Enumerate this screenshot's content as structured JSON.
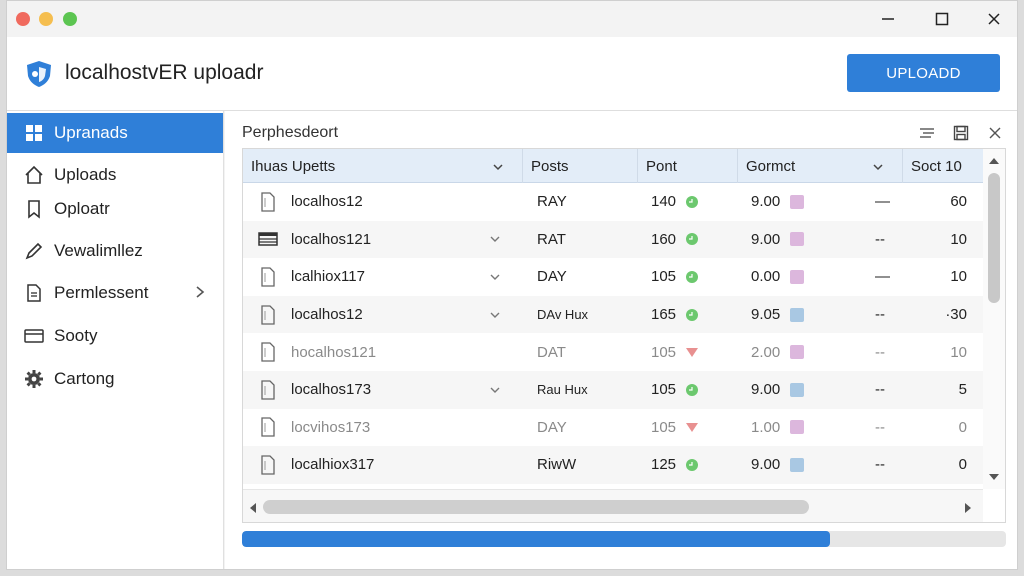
{
  "window": {
    "minimize": "—",
    "maximize": "☐",
    "close": "✕"
  },
  "header": {
    "title": "localhostvER uploadr",
    "upload_label": "UPLOADD"
  },
  "sidebar": {
    "items": [
      {
        "label": "Upranads",
        "icon": "grid-icon",
        "active": true
      },
      {
        "label": "Uploads",
        "icon": "home-icon"
      },
      {
        "label": "Oploatr",
        "icon": "bookmark-icon"
      },
      {
        "label": "Vewalimllez",
        "icon": "pen-icon"
      },
      {
        "label": "Permlessent",
        "icon": "document-icon",
        "chevron": "›"
      },
      {
        "label": "Sooty",
        "icon": "card-icon"
      },
      {
        "label": "Cartong",
        "icon": "gear-icon"
      }
    ]
  },
  "main": {
    "title": "Perphesdeort",
    "columns": [
      "Ihuas Upetts",
      "Posts",
      "Pont",
      "Gormct",
      "Soct 10"
    ],
    "rows": [
      {
        "icon": "file-icon",
        "name": "localhos12",
        "chevron": "",
        "type": "RAY",
        "point": "140",
        "dot": "green",
        "format": "9.00",
        "swatch": "pink",
        "dash": "—",
        "soct": "60"
      },
      {
        "icon": "table-icon",
        "name": "localhos121",
        "chevron": "⌄",
        "type": "RAT",
        "point": "160",
        "dot": "green",
        "format": "9.00",
        "swatch": "pink",
        "dash": "--",
        "soct": "10"
      },
      {
        "icon": "file-icon",
        "name": "lcalhiox117",
        "chevron": "⌄",
        "type": "DAY",
        "point": "105",
        "dot": "green",
        "format": "0.00",
        "swatch": "pink",
        "dash": "—",
        "soct": "10"
      },
      {
        "icon": "file-icon",
        "name": "localhos12",
        "chevron": "⌄",
        "type": "DAv Hux",
        "point": "165",
        "dot": "green",
        "format": "9.05",
        "swatch": "blue",
        "dash": "--",
        "soct": "·30"
      },
      {
        "icon": "file-icon",
        "name": "hocalhos121",
        "chevron": "",
        "type": "DAT",
        "point": "105",
        "dot": "red",
        "format": "2.00",
        "swatch": "pink",
        "dash": "--",
        "soct": "10"
      },
      {
        "icon": "file-icon",
        "name": "localhos173",
        "chevron": "⌄",
        "type": "Rau Hux",
        "point": "105",
        "dot": "green",
        "format": "9.00",
        "swatch": "blue",
        "dash": "--",
        "soct": "5"
      },
      {
        "icon": "file-icon",
        "name": "locvihos173",
        "chevron": "",
        "type": "DAY",
        "point": "105",
        "dot": "red",
        "format": "1.00",
        "swatch": "pink",
        "dash": "--",
        "soct": "0"
      },
      {
        "icon": "file-icon",
        "name": "localhiox317",
        "chevron": "",
        "type": "RiwW",
        "point": "125",
        "dot": "green",
        "format": "9.00",
        "swatch": "blue",
        "dash": "--",
        "soct": "0"
      }
    ],
    "progress": 0.77
  },
  "colors": {
    "accent": "#2f7fd8",
    "dot_green": "#6cc86e",
    "dot_red": "#e89090",
    "swatch_pink": "#dcb7dd",
    "swatch_blue": "#a9c8e3"
  }
}
